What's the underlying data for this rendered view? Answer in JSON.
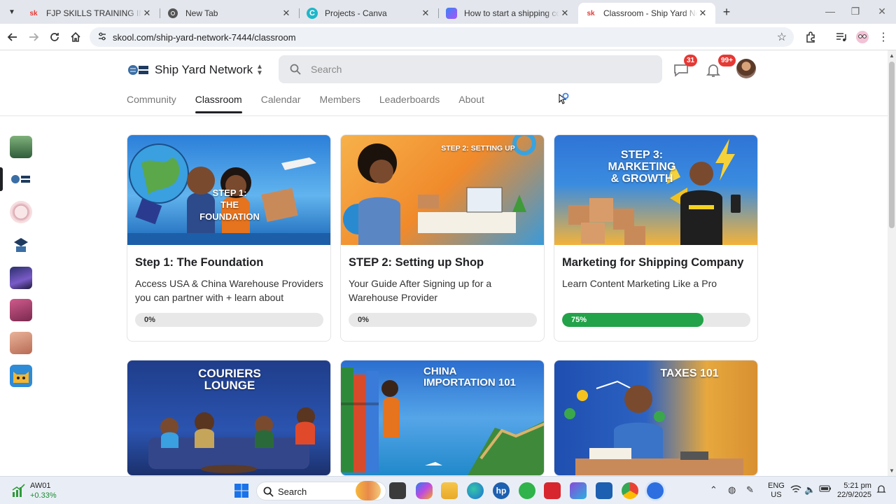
{
  "browser": {
    "tabs": [
      {
        "title": "FJP SKILLS TRAINING INSTITUTE",
        "favicon": "skool-icon",
        "active": false
      },
      {
        "title": "New Tab",
        "favicon": "chrome-icon",
        "active": false
      },
      {
        "title": "Projects - Canva",
        "favicon": "canva-icon",
        "active": false
      },
      {
        "title": "How to start a shipping company",
        "favicon": "copilot-icon",
        "active": false
      },
      {
        "title": "Classroom - Ship Yard Network",
        "favicon": "skool-icon",
        "active": true
      }
    ],
    "url": "skool.com/ship-yard-network-7444/classroom"
  },
  "header": {
    "group_name": "Ship Yard Network",
    "search_placeholder": "Search",
    "chat_badge": "31",
    "notifications_badge": "99+",
    "nav": [
      "Community",
      "Classroom",
      "Calendar",
      "Members",
      "Leaderboards",
      "About"
    ],
    "active_nav": "Classroom"
  },
  "courses": [
    {
      "image_text": "STEP 1:\nTHE FOUNDATION",
      "title": "Step 1: The Foundation",
      "description": "Access USA & China Warehouse Providers you can partner with + learn about Business...",
      "progress": 0,
      "progress_label": "0%"
    },
    {
      "image_text": "STEP 2: SETTING UP",
      "title": "STEP 2: Setting up Shop",
      "description": "Your Guide After Signing up for a Warehouse Provider",
      "progress": 0,
      "progress_label": "0%"
    },
    {
      "image_text": "STEP 3:\nMARKETING\n& GROWTH",
      "title": "Marketing for Shipping Company",
      "description": "Learn Content Marketing Like a Pro",
      "progress": 75,
      "progress_label": "75%"
    },
    {
      "image_text": "COURIERS\nLOUNGE"
    },
    {
      "image_text": "CHINA\nIMPORTATION 101"
    },
    {
      "image_text": "TAXES 101"
    }
  ],
  "taskbar": {
    "stock_name": "AW01",
    "stock_change": "+0.33%",
    "search_placeholder": "Search",
    "lang_line1": "ENG",
    "lang_line2": "US",
    "time": "5:21 pm",
    "date": "22/9/2025"
  },
  "colors": {
    "progress_fill": "#22a249",
    "badge": "#e53935",
    "active_text": "#202124"
  }
}
